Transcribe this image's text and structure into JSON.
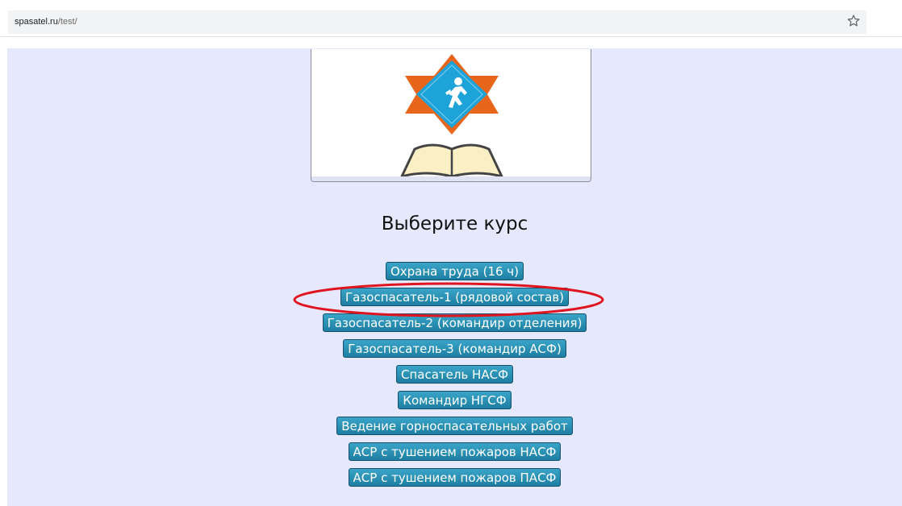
{
  "browser": {
    "url_domain": "spasatel.ru",
    "url_path": "/test/",
    "bookmark_icon": "star-outline-icon"
  },
  "page": {
    "background": "#e6e9fe",
    "logo": {
      "icon": "rescuer-emblem-book-icon",
      "colors": {
        "star_orange": "#e8661c",
        "diamond_blue": "#1ea3d8",
        "book_cream": "#fbefc6"
      }
    },
    "heading": "Выберите курс",
    "courses": [
      "Охрана труда (16 ч)",
      "Газоспасатель-1 (рядовой состав)",
      "Газоспасатель-2 (командир отделения)",
      "Газоспасатель-3 (командир АСФ)",
      "Спасатель НАСФ",
      "Командир НГСФ",
      "Ведение горноспасательных работ",
      "АСР с тушением пожаров НАСФ",
      "АСР с тушением пожаров ПАСФ"
    ],
    "highlight": {
      "course_index": 1,
      "color": "#e0141e"
    }
  }
}
